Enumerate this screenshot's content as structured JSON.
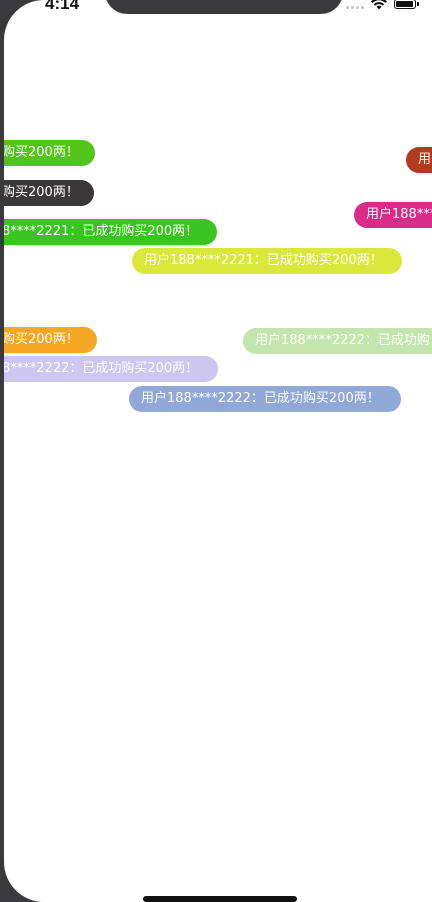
{
  "status_bar": {
    "time": "4:14"
  },
  "danmaku": [
    {
      "text": "购买200两！",
      "color": "#52c41a"
    },
    {
      "text": "用",
      "color": "#b23a1d"
    },
    {
      "text": "购买200两！",
      "color": "#3b3839"
    },
    {
      "text": "用户188***",
      "color": "#d92b8a"
    },
    {
      "text": "8****2221：已成功购买200两！",
      "color": "#3ac41f"
    },
    {
      "text": "用户188****2221：已成功购买200两！",
      "color": "#d9e83a"
    },
    {
      "text": "购买200两！",
      "color": "#f5a623"
    },
    {
      "text": "用户188****2222：已成功购",
      "color": "#c2e6ad"
    },
    {
      "text": "8****2222：已成功购买200两！",
      "color": "#cdc6f0"
    },
    {
      "text": "用户188****2222：已成功购买200两！",
      "color": "#8fa8d8"
    }
  ]
}
